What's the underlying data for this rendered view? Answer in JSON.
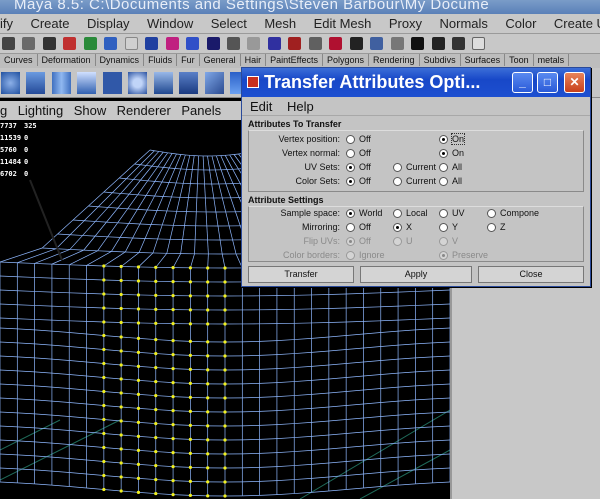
{
  "window": {
    "title": "Maya 8.5: C:\\Documents and Settings\\Steven Barbour\\My Docume"
  },
  "menubar": [
    "ify",
    "Create",
    "Display",
    "Window",
    "Select",
    "Mesh",
    "Edit Mesh",
    "Proxy",
    "Normals",
    "Color",
    "Create UVs"
  ],
  "shelf_tabs": [
    "Curves",
    "Deformation",
    "Dynamics",
    "Fluids",
    "Fur",
    "General",
    "Hair",
    "PaintEffects",
    "Polygons",
    "Rendering",
    "Subdivs",
    "Surfaces",
    "Toon",
    "metals"
  ],
  "panel_menu": [
    "g",
    "Lighting",
    "Show",
    "Renderer",
    "Panels"
  ],
  "hud": [
    {
      "a": "7737",
      "b": "325"
    },
    {
      "a": "11539",
      "b": "0"
    },
    {
      "a": "5760",
      "b": "0"
    },
    {
      "a": "11484",
      "b": "0"
    },
    {
      "a": "6702",
      "b": "0"
    }
  ],
  "dialog": {
    "title": "Transfer Attributes Opti...",
    "menu": {
      "edit": "Edit",
      "help": "Help"
    },
    "section1": {
      "title": "Attributes To Transfer",
      "rows": [
        {
          "label": "Vertex position:",
          "options": [
            "Off",
            "On"
          ],
          "selected": "On"
        },
        {
          "label": "Vertex normal:",
          "options": [
            "Off",
            "On"
          ],
          "selected": "On"
        },
        {
          "label": "UV Sets:",
          "options": [
            "Off",
            "Current",
            "All"
          ],
          "selected": "Off"
        },
        {
          "label": "Color Sets:",
          "options": [
            "Off",
            "Current",
            "All"
          ],
          "selected": "Off"
        }
      ]
    },
    "section2": {
      "title": "Attribute Settings",
      "rows": [
        {
          "label": "Sample space:",
          "options": [
            "World",
            "Local",
            "UV",
            "Compone"
          ],
          "selected": "World",
          "enabled": true
        },
        {
          "label": "Mirroring:",
          "options": [
            "Off",
            "X",
            "Y",
            "Z"
          ],
          "selected": "X",
          "enabled": true
        },
        {
          "label": "Flip UVs:",
          "options": [
            "Off",
            "U",
            "V"
          ],
          "selected": "Off",
          "enabled": false
        },
        {
          "label": "Color borders:",
          "options": [
            "Ignore",
            "Preserve"
          ],
          "selected": "Preserve",
          "enabled": false
        }
      ]
    },
    "buttons": {
      "transfer": "Transfer",
      "apply": "Apply",
      "close": "Close"
    }
  },
  "colors": {
    "wire": "#8fb8ff",
    "selected_vertex": "#f0f020",
    "grid": "#1f6b5a",
    "titlebar": "#1d4fd0"
  }
}
